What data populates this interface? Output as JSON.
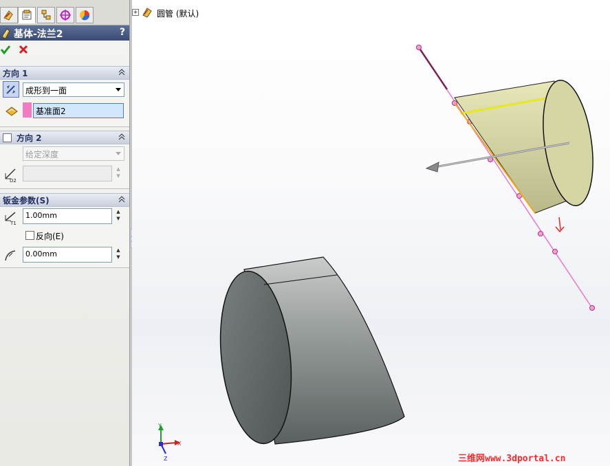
{
  "feature": {
    "title": "基体-法兰2",
    "help_label": "?"
  },
  "direction1": {
    "header": "方向 1",
    "end_condition": "成形到一面",
    "reference": "基准面2"
  },
  "direction2": {
    "header": "方向 2",
    "end_condition": "给定深度",
    "depth_value": ""
  },
  "sheetmetal": {
    "header": "钣金参数(S)",
    "thickness": "1.00mm",
    "reverse_label": "反向(E)",
    "bend_radius": "0.00mm"
  },
  "tree": {
    "root_label": "圆管  (默认)"
  },
  "triad": {
    "x": "X",
    "y": "Y",
    "z": "Z"
  },
  "watermark": "三维网www.3dportal.cn",
  "colors": {
    "accent_title": "#3b4b73",
    "sketch_pink": "#e67ac8",
    "preview_yellow": "#e8e879",
    "body_gray": "#7f8584",
    "ok_green": "#1f9a2a",
    "cancel_red": "#d42020"
  }
}
